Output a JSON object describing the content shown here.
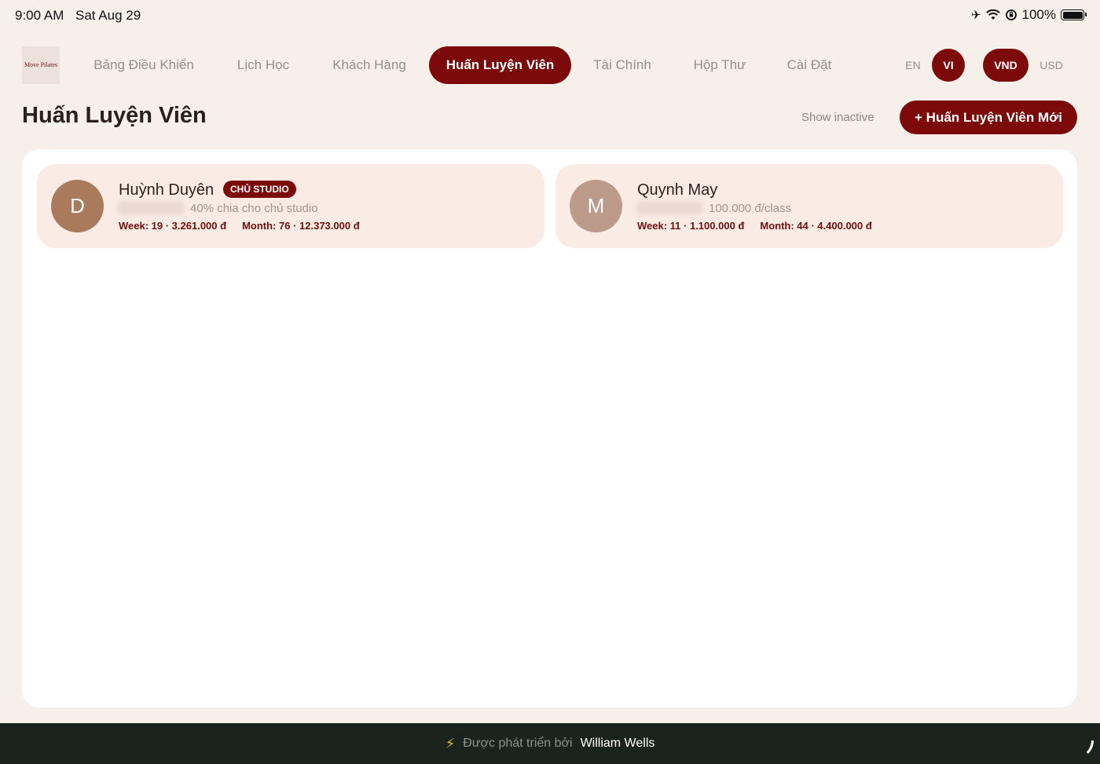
{
  "status": {
    "time": "9:00 AM",
    "date": "Sat Aug 29",
    "battery": "100%"
  },
  "logo": {
    "text": "Move Pilates"
  },
  "nav": {
    "tabs": [
      {
        "label": "Bảng Điều Khiển"
      },
      {
        "label": "Lịch Học"
      },
      {
        "label": "Khách Hàng"
      },
      {
        "label": "Huấn Luyện Viên"
      },
      {
        "label": "Tài Chính"
      },
      {
        "label": "Hộp Thư"
      },
      {
        "label": "Cài Đặt"
      }
    ],
    "active_tab": "Huấn Luyện Viên",
    "languages": [
      "EN",
      "VI"
    ],
    "active_language": "VI",
    "currencies": [
      "VND",
      "USD"
    ],
    "active_currency": "VND"
  },
  "header": {
    "title": "Huấn Luyện Viên",
    "show_inactive": "Show inactive",
    "new_button": "+ Huấn Luyện Viên Mới"
  },
  "trainers": [
    {
      "initial": "D",
      "name": "Huỳnh Duyên",
      "badge": "CHỦ STUDIO",
      "rate": "40% chia cho chủ studio",
      "week": "Week: 19 · 3.261.000 đ",
      "month": "Month: 76 · 12.373.000 đ",
      "avatar_color": "#a97b5c"
    },
    {
      "initial": "M",
      "name": "Quynh May",
      "badge": "",
      "rate": "100.000 đ/class",
      "week": "Week: 11 · 1.100.000 đ",
      "month": "Month: 44 · 4.400.000 đ",
      "avatar_color": "#bc9b8a"
    }
  ],
  "footer": {
    "text": "Được phát triển bởi",
    "author": "William Wells"
  },
  "colors": {
    "accent": "#7d0a0a",
    "background": "#f6efea",
    "card": "#fbebe5",
    "footer": "#1b231e"
  }
}
